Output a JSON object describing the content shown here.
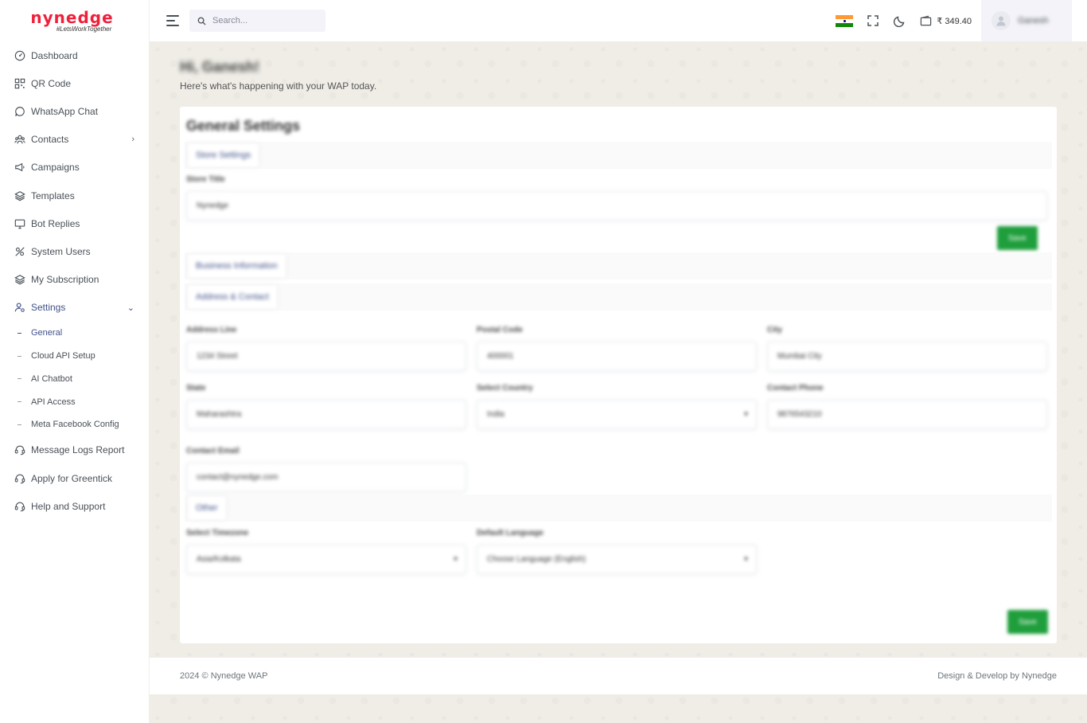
{
  "brand": {
    "name": "nynedge",
    "tagline": "#LetsWorkTogether",
    "color": "#f0203a"
  },
  "sidebar": {
    "items": [
      {
        "label": "Dashboard",
        "icon": "dashboard-icon"
      },
      {
        "label": "QR Code",
        "icon": "qr-code-icon"
      },
      {
        "label": "WhatsApp Chat",
        "icon": "chat-bubble-icon"
      },
      {
        "label": "Contacts",
        "icon": "contacts-icon",
        "has_caret": true
      },
      {
        "label": "Campaigns",
        "icon": "megaphone-icon"
      },
      {
        "label": "Templates",
        "icon": "layers-icon"
      },
      {
        "label": "Bot Replies",
        "icon": "monitor-icon"
      },
      {
        "label": "System Users",
        "icon": "users-tool-icon"
      },
      {
        "label": "My Subscription",
        "icon": "layers-icon"
      },
      {
        "label": "Settings",
        "icon": "user-settings-icon",
        "expanded": true
      }
    ],
    "settings_sub": [
      "General",
      "Cloud API Setup",
      "AI Chatbot",
      "API Access",
      "Meta Facebook Config"
    ],
    "bottom_items": [
      {
        "label": "Message Logs Report",
        "icon": "headset-icon"
      },
      {
        "label": "Apply for Greentick",
        "icon": "headset-icon"
      },
      {
        "label": "Help and Support",
        "icon": "headset-icon"
      }
    ]
  },
  "topbar": {
    "search_placeholder": "Search...",
    "balance": "₹ 349.40",
    "user_name": "Ganesh"
  },
  "page": {
    "greeting": "Hi, Ganesh!",
    "subtitle": "Here's what's happening with your WAP today.",
    "card_title": "General Settings",
    "tabs": {
      "store": "Store Settings",
      "business": "Business Information",
      "address": "Address & Contact",
      "other": "Other"
    },
    "fields": {
      "store_title_label": "Store Title",
      "store_title_value": "Nynedge",
      "address_line_label": "Address Line",
      "address_line_value": "1234 Street",
      "postal_code_label": "Postal Code",
      "postal_code_value": "400001",
      "city_label": "City",
      "city_value": "Mumbai City",
      "state_label": "State",
      "state_value": "Maharashtra",
      "country_label": "Select Country",
      "country_value": "India",
      "phone_label": "Contact Phone",
      "phone_value": "9876543210",
      "email_label": "Contact Email",
      "email_value": "contact@nynedge.com",
      "timezone_label": "Select Timezone",
      "timezone_value": "Asia/Kolkata",
      "language_label": "Default Language",
      "language_value": "Choose Language (English)"
    },
    "save_label": "Save"
  },
  "footer": {
    "copyright": "2024 © Nynedge WAP",
    "credit": "Design & Develop by Nynedge"
  },
  "colors": {
    "accent": "#405189",
    "save": "#1f9e3c"
  }
}
